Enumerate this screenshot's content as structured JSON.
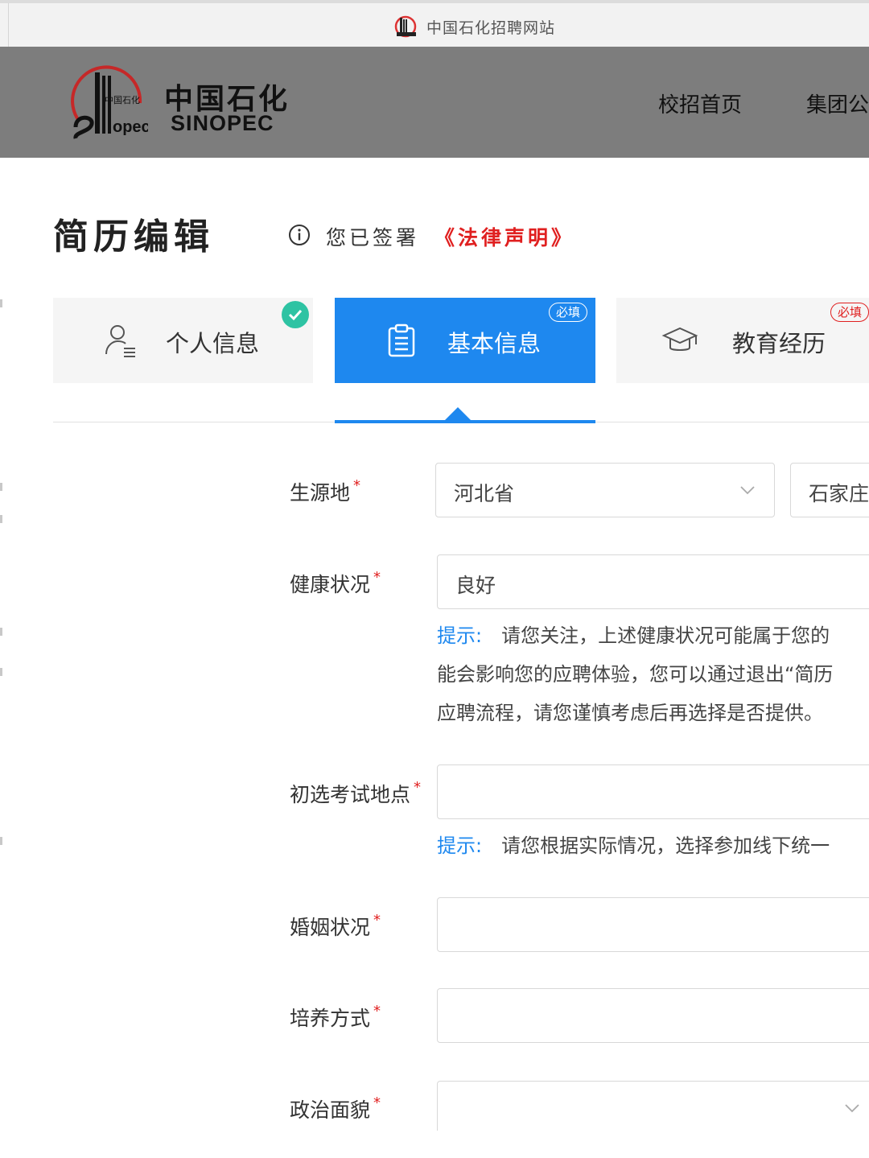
{
  "browser": {
    "tab_title": "中国石化招聘网站",
    "favicon": "sinopec-logo-icon"
  },
  "header": {
    "logo_cn": "中国石化",
    "logo_en": "SINOPEC",
    "nav": [
      "校招首页",
      "集团公"
    ]
  },
  "page": {
    "title": "简历编辑",
    "signed_text": "您已签署",
    "law_link": "《法律声明》"
  },
  "steps": [
    {
      "label": "个人信息",
      "icon": "person-list-icon",
      "status": "completed"
    },
    {
      "label": "基本信息",
      "icon": "clipboard-icon",
      "badge": "必填",
      "active": true
    },
    {
      "label": "教育经历",
      "icon": "graduation-cap-icon",
      "badge": "必填"
    }
  ],
  "form": {
    "origin": {
      "label": "生源地",
      "required": "*",
      "province": "河北省",
      "city": "石家庄"
    },
    "health": {
      "label": "健康状况",
      "required": "*",
      "value": "良好",
      "hint_key": "提示:",
      "hint_lines": [
        "请您关注，上述健康状况可能属于您的",
        "能会影响您的应聘体验，您可以通过退出“简历",
        "应聘流程，请您谨慎考虑后再选择是否提供。"
      ]
    },
    "exam_location": {
      "label": "初选考试地点",
      "required": "*",
      "value": "",
      "hint_key": "提示:",
      "hint": "请您根据实际情况，选择参加线下统一"
    },
    "marital": {
      "label": "婚姻状况",
      "required": "*",
      "value": ""
    },
    "training": {
      "label": "培养方式",
      "required": "*",
      "value": ""
    },
    "political": {
      "label": "政治面貌",
      "required": "*",
      "value": ""
    }
  },
  "colors": {
    "accent": "#1e88ef",
    "required": "#e02020",
    "header_bg": "#7d7d7d",
    "success": "#2ec3a3"
  }
}
